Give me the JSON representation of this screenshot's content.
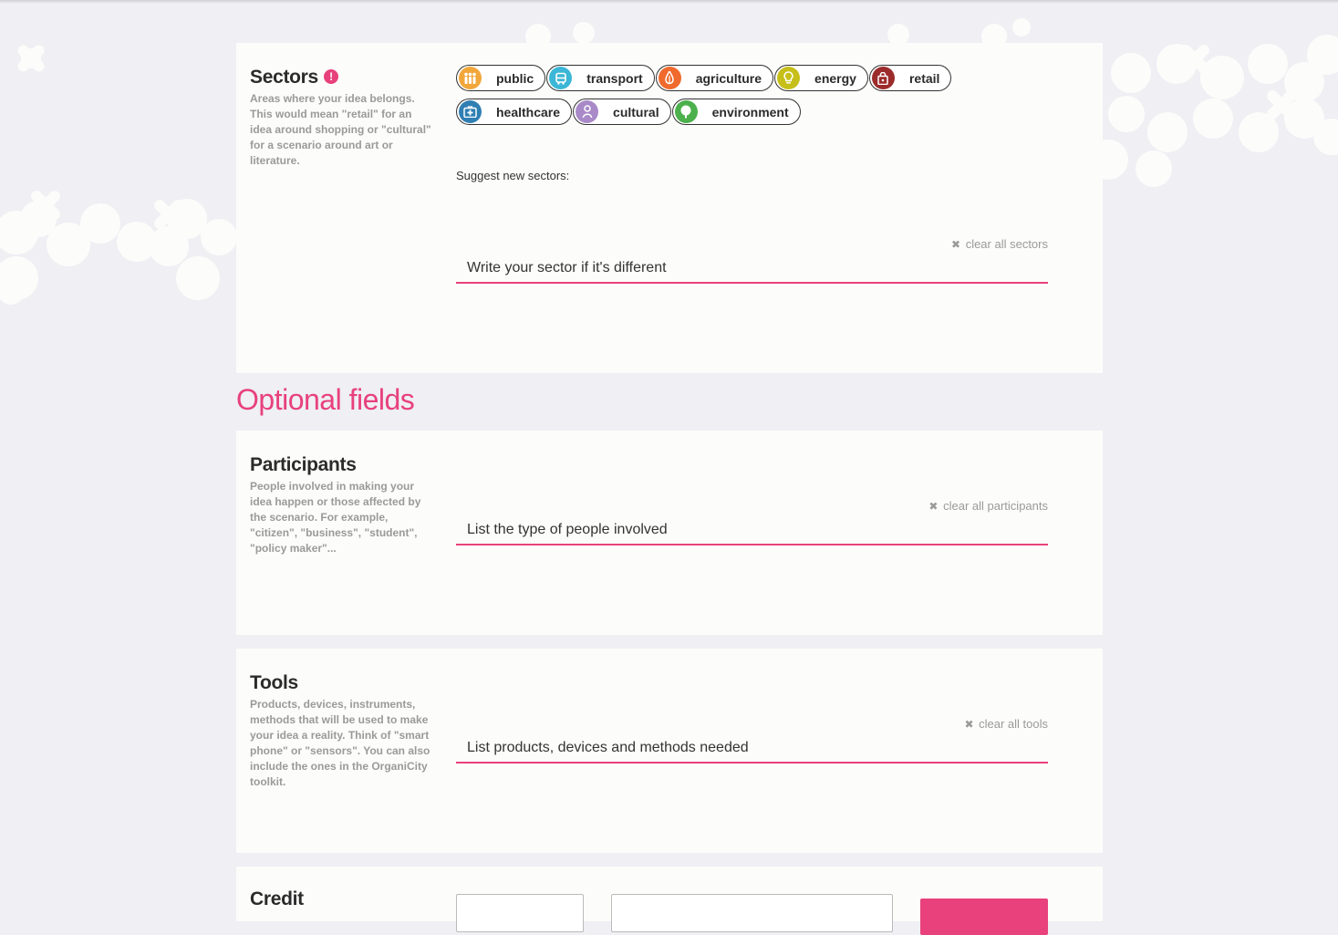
{
  "sectors": {
    "title": "Sectors",
    "alert_glyph": "!",
    "description": "Areas where your idea belongs. This would mean \"retail\" for an idea around shopping or \"cultural\" for a scenario around art or literature.",
    "chips": [
      {
        "label": "public",
        "icon": "people-icon",
        "color": "#f2a73b"
      },
      {
        "label": "transport",
        "icon": "bus-icon",
        "color": "#3bb6d6"
      },
      {
        "label": "agriculture",
        "icon": "flame-icon",
        "color": "#ef6a2c"
      },
      {
        "label": "energy",
        "icon": "lightbulb-icon",
        "color": "#c7bf19"
      },
      {
        "label": "retail",
        "icon": "shopping-bag-icon",
        "color": "#9c2b2b"
      },
      {
        "label": "healthcare",
        "icon": "medical-cross-icon",
        "color": "#2f7fb3"
      },
      {
        "label": "cultural",
        "icon": "person-icon",
        "color": "#a989c8"
      },
      {
        "label": "environment",
        "icon": "tree-icon",
        "color": "#4cb04c"
      }
    ],
    "suggest_label": "Suggest new sectors:",
    "clear_label": "clear all sectors",
    "clear_glyph": "✖",
    "input_placeholder": "Write your sector if it's different"
  },
  "optional_heading": "Optional fields",
  "participants": {
    "title": "Participants",
    "description": "People involved in making your idea happen or those affected by the scenario. For example, \"citizen\", \"business\", \"student\", \"policy maker\"...",
    "clear_label": "clear all participants",
    "clear_glyph": "✖",
    "input_placeholder": "List the type of people involved"
  },
  "tools": {
    "title": "Tools",
    "description": "Products, devices, instruments, methods that will be used to make your idea a reality. Think of \"smart phone\" or \"sensors\". You can also include the ones in the OrganiCity toolkit.",
    "clear_label": "clear all tools",
    "clear_glyph": "✖",
    "input_placeholder": "List products, devices and methods needed"
  },
  "credit": {
    "title": "Credit"
  },
  "colors": {
    "accent": "#e8417c",
    "panel": "#fcfdfa",
    "background": "#efeff4",
    "muted_text": "#9a9a9a"
  }
}
